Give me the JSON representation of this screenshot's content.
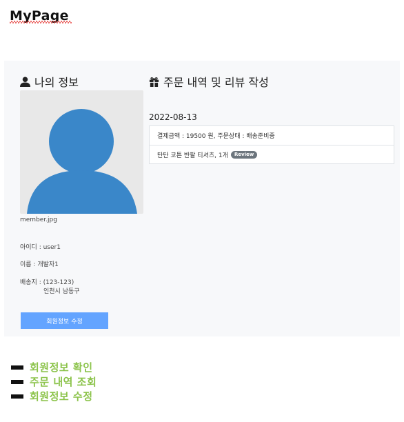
{
  "header": {
    "title": "MyPage"
  },
  "profile": {
    "section_title": "나의 정보",
    "photo_caption": "member.jpg",
    "id_line": "아이디 : user1",
    "name_line": "이름 : 개발자1",
    "address_line1": "배송지 : (123-123)",
    "address_line2": "인천시 남동구",
    "edit_button_label": "회원정보 수정"
  },
  "orders": {
    "section_title": "주문 내역 및 리뷰 작성",
    "date": "2022-08-13",
    "summary": "결제금액 : 19500 원, 주문상태 : 배송준비중",
    "item": "탄탄 코튼 반팔 티셔츠, 1개",
    "review_badge": "Review"
  },
  "menu": {
    "items": [
      {
        "label": "회원정보 확인"
      },
      {
        "label": "주문 내역 조회"
      },
      {
        "label": "회원정보 수정"
      }
    ]
  },
  "colors": {
    "accent_button": "#63a4ff",
    "menu_text": "#8bc34a",
    "avatar": "#3a87c9",
    "panel_bg": "#f7f8fa"
  }
}
